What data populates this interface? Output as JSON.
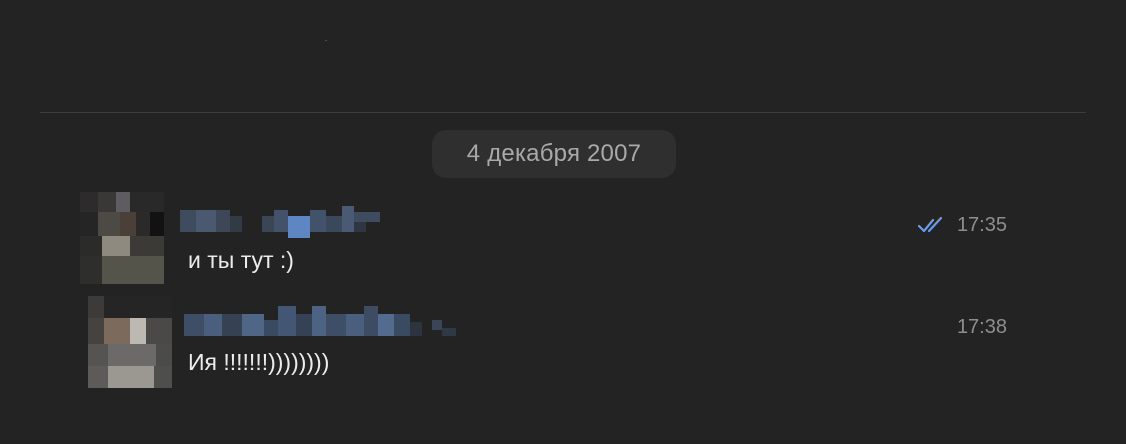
{
  "date_separator": "4 декабря 2007",
  "messages": [
    {
      "text": "и ты тут :)",
      "time": "17:35",
      "status_icon": "double-check-icon",
      "status_color": "#6d9be4"
    },
    {
      "text": "Ия !!!!!!!))))))))",
      "time": "17:38"
    }
  ],
  "colors": {
    "background": "#232323",
    "pill": "#2f2f2f",
    "message_text": "#ececec",
    "time_text": "#8e8e8e",
    "read_check": "#6d9be4"
  }
}
